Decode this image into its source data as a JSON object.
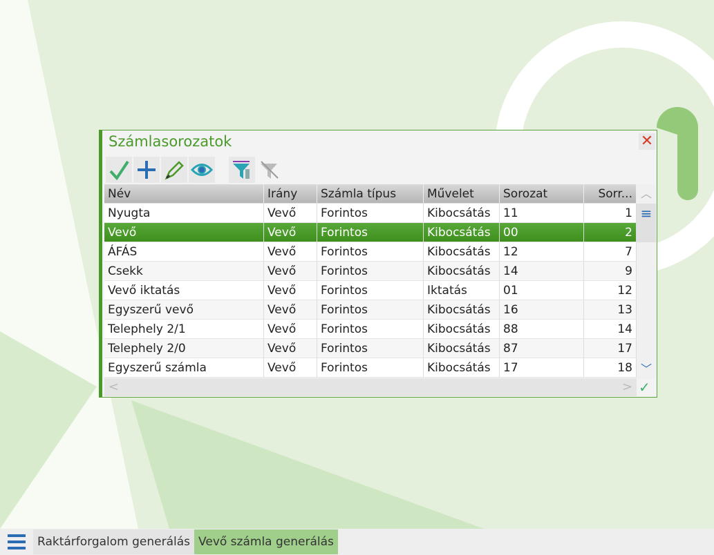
{
  "window": {
    "title": "Számlasorozatok"
  },
  "toolbar": [
    "accept",
    "add",
    "edit",
    "view",
    "filter",
    "clear-filter"
  ],
  "table": {
    "headers": [
      "Név",
      "Irány",
      "Számla típus",
      "Művelet",
      "Sorozat",
      "Sorr..."
    ],
    "rows": [
      [
        "Nyugta",
        "Vevő",
        "Forintos",
        "Kibocsátás",
        "11",
        "1"
      ],
      [
        "Vevő",
        "Vevő",
        "Forintos",
        "Kibocsátás",
        "00",
        "2"
      ],
      [
        "ÁFÁS",
        "Vevő",
        "Forintos",
        "Kibocsátás",
        "12",
        "7"
      ],
      [
        "Csekk",
        "Vevő",
        "Forintos",
        "Kibocsátás",
        "14",
        "9"
      ],
      [
        "Vevő iktatás",
        "Vevő",
        "Forintos",
        "Iktatás",
        "01",
        "12"
      ],
      [
        "Egyszerű vevő",
        "Vevő",
        "Forintos",
        "Kibocsátás",
        "16",
        "13"
      ],
      [
        "Telephely 2/1",
        "Vevő",
        "Forintos",
        "Kibocsátás",
        "88",
        "14"
      ],
      [
        "Telephely 2/0",
        "Vevő",
        "Forintos",
        "Kibocsátás",
        "87",
        "17"
      ],
      [
        "Egyszerű számla",
        "Vevő",
        "Forintos",
        "Kibocsátás",
        "17",
        "18"
      ]
    ],
    "selected_index": 1
  },
  "taskbar": {
    "tabs": [
      "Raktárforgalom generálás",
      "Vevő számla generálás"
    ],
    "active": 1
  },
  "colors": {
    "accent": "#4a9a2a",
    "selected": "#4c9c2c"
  }
}
